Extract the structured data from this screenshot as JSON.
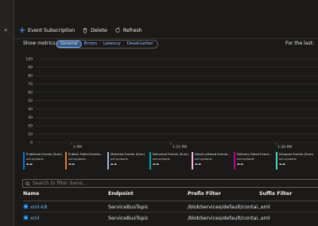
{
  "nav": {
    "collapse_glyph": "«"
  },
  "toolbar": {
    "event_subscription_label": "Event Subscription",
    "delete_label": "Delete",
    "refresh_label": "Refresh"
  },
  "metrics": {
    "label": "Show metrics:",
    "tabs": [
      "General",
      "Errors",
      "Latency",
      "Dead-Letter"
    ],
    "active_tab": "General",
    "for_the_last_label": "For the last:"
  },
  "chart_data": {
    "type": "line",
    "y_ticks": [
      "100",
      "90",
      "80",
      "70",
      "60",
      "50",
      "40",
      "30",
      "20",
      "10",
      "0"
    ],
    "ylim": [
      0,
      100
    ],
    "x_ticks": [
      "1 PM",
      "1:15 PM",
      "1:30 PM"
    ],
    "series": [
      {
        "name": "Published Events (Sum)",
        "subtitle": "azf-uploads",
        "value": "--",
        "color": "#0078d4"
      },
      {
        "name": "Publish Failed Events...",
        "subtitle": "azf-uploads",
        "value": "--",
        "color": "#e07a2e"
      },
      {
        "name": "Matched Events (Sum)",
        "subtitle": "azf-uploads",
        "value": "--",
        "color": "#9bb7e6"
      },
      {
        "name": "Delivered Events (Sum)",
        "subtitle": "azf-uploads",
        "value": "--",
        "color": "#00a5a8"
      },
      {
        "name": "Dead Lettered Events...",
        "subtitle": "azf-uploads",
        "value": "--",
        "color": "#f3b7e0"
      },
      {
        "name": "Delivery Failed Event...",
        "subtitle": "azf-uploads",
        "value": "--",
        "color": "#c3008a"
      },
      {
        "name": "Dropped Events (Sum)",
        "subtitle": "azf-uploads",
        "value": "--",
        "color": "#4fd1c5"
      }
    ]
  },
  "search": {
    "placeholder": "Search to filter items..."
  },
  "table": {
    "headers": [
      "Name",
      "Endpoint",
      "Prefix Filter",
      "Suffix Filter"
    ],
    "rows": [
      {
        "name": "xml-k8",
        "endpoint": "ServiceBusTopic",
        "prefix": "/blobServices/default/contai...",
        "suffix": ".xml"
      },
      {
        "name": "xml",
        "endpoint": "ServiceBusTopic",
        "prefix": "/blobServices/default/contai...",
        "suffix": ".xml"
      }
    ]
  }
}
